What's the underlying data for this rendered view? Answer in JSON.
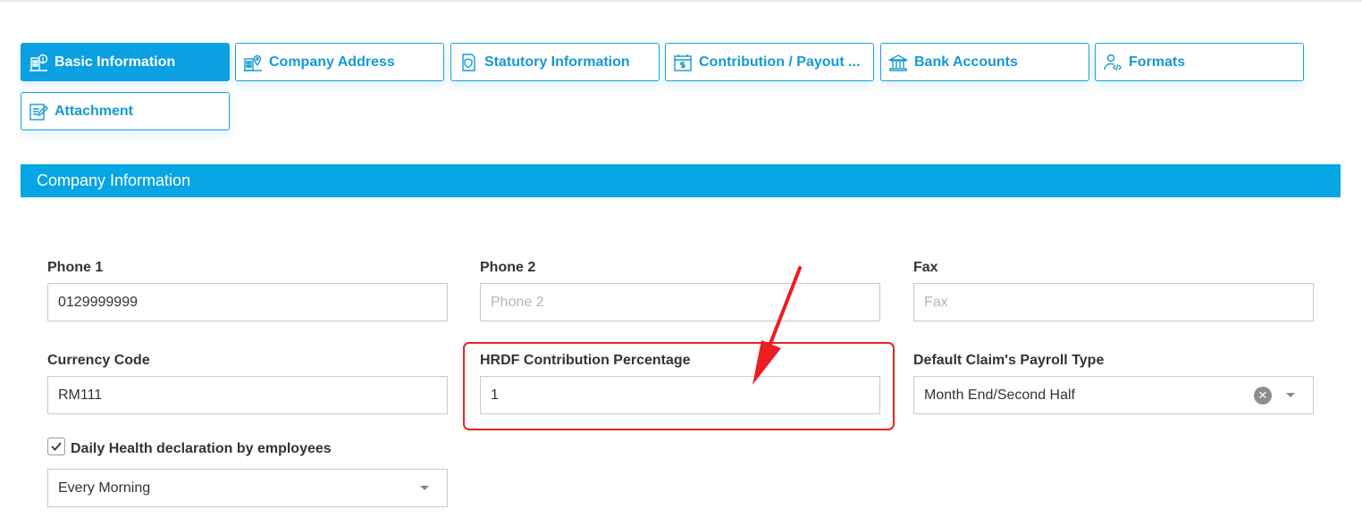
{
  "tabs": [
    {
      "label": "Basic Information",
      "icon": "building-info-icon",
      "active": true
    },
    {
      "label": "Company Address",
      "icon": "building-location-icon",
      "active": false
    },
    {
      "label": "Statutory Information",
      "icon": "document-shield-icon",
      "active": false
    },
    {
      "label": "Contribution / Payout ...",
      "icon": "calendar-dollar-icon",
      "active": false
    },
    {
      "label": "Bank Accounts",
      "icon": "bank-icon",
      "active": false
    },
    {
      "label": "Formats",
      "icon": "user-code-icon",
      "active": false
    },
    {
      "label": "Attachment",
      "icon": "attachment-edit-icon",
      "active": false
    }
  ],
  "section": {
    "title": "Company Information"
  },
  "fields": {
    "phone1": {
      "label": "Phone 1",
      "value": "0129999999",
      "placeholder": ""
    },
    "phone2": {
      "label": "Phone 2",
      "value": "",
      "placeholder": "Phone 2"
    },
    "fax": {
      "label": "Fax",
      "value": "",
      "placeholder": "Fax"
    },
    "currency": {
      "label": "Currency Code",
      "value": "RM111"
    },
    "hrdf": {
      "label": "HRDF Contribution Percentage",
      "value": "1"
    },
    "claim_payroll": {
      "label": "Default Claim's Payroll Type",
      "value": "Month End/Second Half"
    },
    "health": {
      "label": "Daily Health declaration by employees",
      "checked": true,
      "value": "Every Morning"
    }
  },
  "colors": {
    "accent": "#0aa0e2",
    "section": "#06a5e3",
    "highlight": "#e8231f",
    "arrow": "#ee1c24"
  }
}
